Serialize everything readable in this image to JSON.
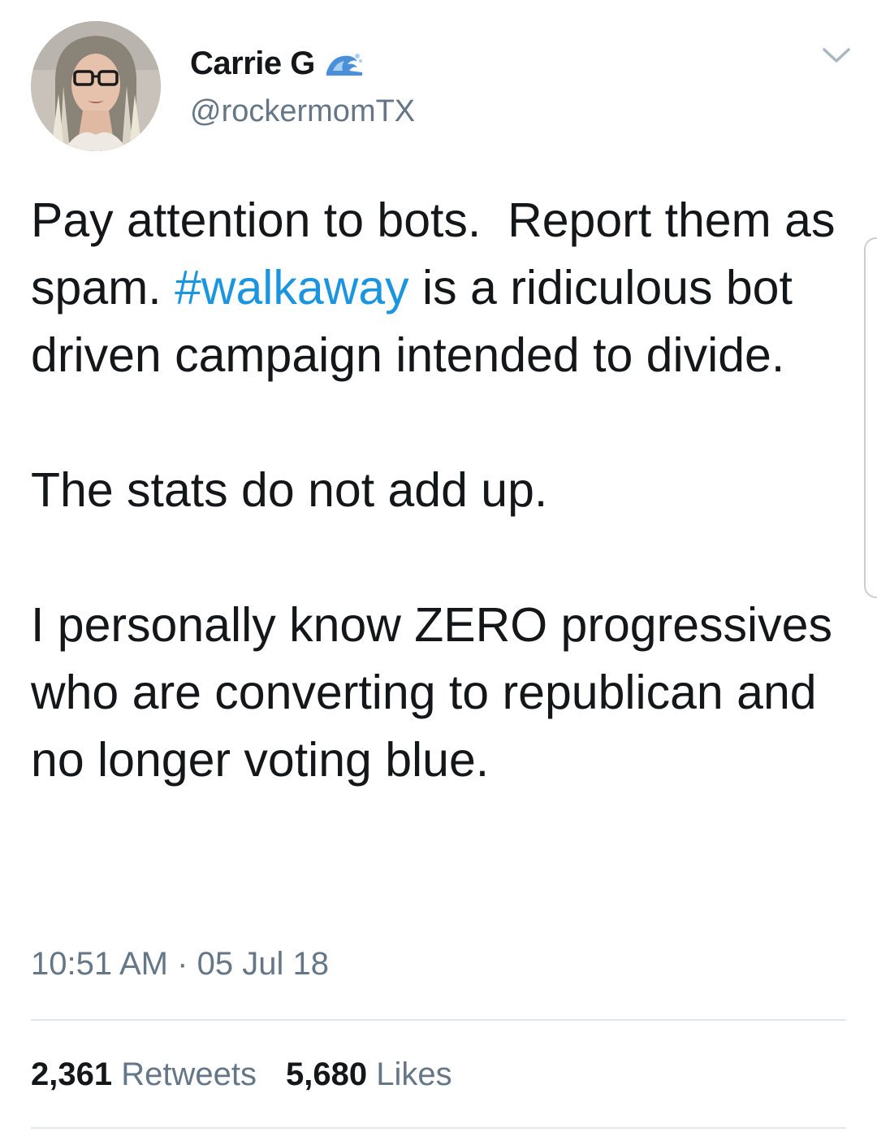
{
  "author": {
    "display_name": "Carrie G",
    "handle": "@rockermomTX",
    "badge_icon": "water-wave-icon",
    "menu_icon": "chevron-down-icon"
  },
  "tweet": {
    "paragraph1": {
      "before_hashtag": "Pay attention to bots.  Report them as spam. ",
      "hashtag": "#walkaway",
      "after_hashtag": " is a ridiculous bot driven campaign intended to divide."
    },
    "paragraph2": "The stats do not add up.",
    "paragraph3": "I personally know ZERO progressives who are converting to republican and no longer voting blue."
  },
  "meta": {
    "time": "10:51 AM",
    "separator": "·",
    "date": "05 Jul 18"
  },
  "stats": {
    "retweets_count": "2,361",
    "retweets_label": "Retweets",
    "likes_count": "5,680",
    "likes_label": "Likes"
  },
  "colors": {
    "hashtag": "#1b95e0",
    "secondary_text": "#657786",
    "primary_text": "#14171a",
    "divider": "#e1e8ed"
  }
}
